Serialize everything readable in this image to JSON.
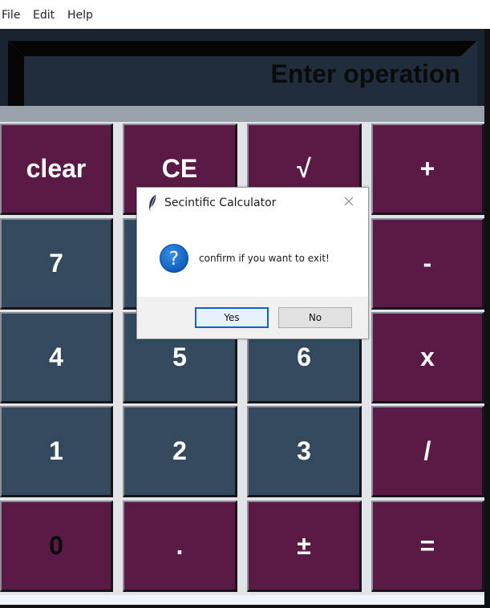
{
  "menu": {
    "file": "File",
    "edit": "Edit",
    "help": "Help"
  },
  "display": {
    "text": "Enter operation"
  },
  "buttons": {
    "clear": "clear",
    "ce": "CE",
    "sqrt": "√",
    "plus": "+",
    "seven": "7",
    "minus": "-",
    "four": "4",
    "five": "5",
    "six": "6",
    "multiply": "x",
    "one": "1",
    "two": "2",
    "three": "3",
    "divide": "/",
    "zero": "0",
    "dot": ".",
    "plusminus": "±",
    "equals": "="
  },
  "dialog": {
    "title": "Secintific Calculator",
    "message": "confirm if you want to exit!",
    "yes": "Yes",
    "no": "No",
    "icon": "question-icon"
  },
  "colors": {
    "maroon": "#5a1a45",
    "slate": "#334a5e",
    "display_bg": "#1f2d3d",
    "accent": "#0a64c8"
  }
}
